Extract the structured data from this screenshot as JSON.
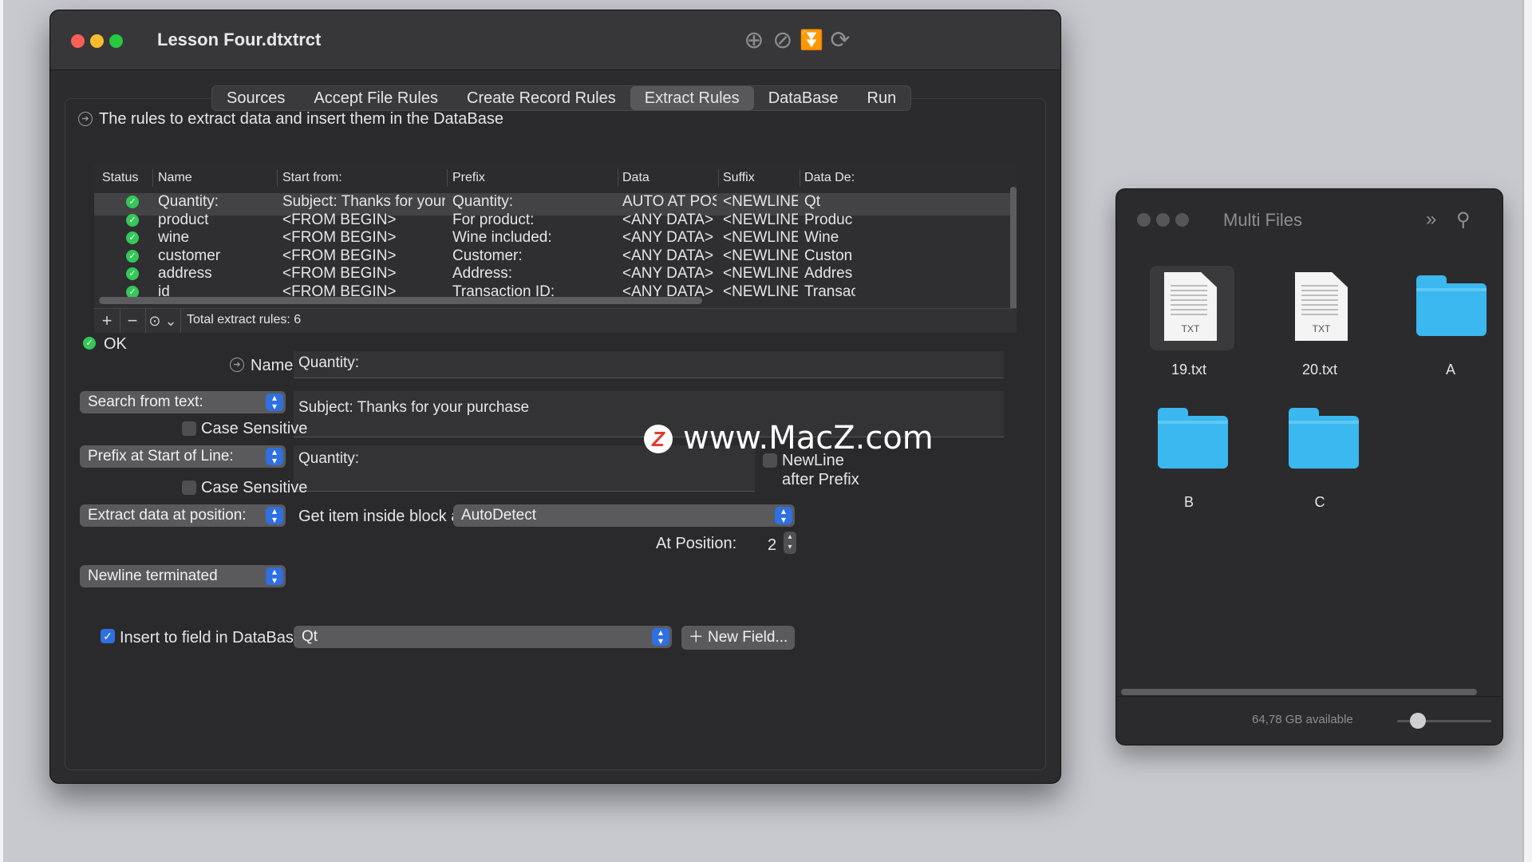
{
  "window": {
    "title": "Lesson Four.dtxtrct",
    "toolbar_icons": [
      "add-circle-icon",
      "block-icon",
      "funnel-icon",
      "refresh-icon"
    ]
  },
  "tabs": [
    "Sources",
    "Accept File Rules",
    "Create Record Rules",
    "Extract Rules",
    "DataBase",
    "Run"
  ],
  "active_tab": "Extract Rules",
  "description": "The rules to extract data and insert them in the DataBase",
  "table": {
    "headers": [
      "Status",
      "Name",
      "Start from:",
      "Prefix",
      "Data",
      "Suffix",
      "Data De:"
    ],
    "rows": [
      {
        "name": "Quantity:",
        "start": "Subject: Thanks for your p...",
        "prefix": "Quantity:",
        "data": "AUTO AT POS...",
        "suffix": "<NEWLINE>",
        "dest": "Qt"
      },
      {
        "name": "product",
        "start": "<FROM BEGIN>",
        "prefix": "For product:",
        "data": "<ANY DATA>",
        "suffix": "<NEWLINE>",
        "dest": "Produc"
      },
      {
        "name": "wine",
        "start": "<FROM BEGIN>",
        "prefix": "Wine included:",
        "data": "<ANY DATA>",
        "suffix": "<NEWLINE>",
        "dest": "Wine"
      },
      {
        "name": "customer",
        "start": "<FROM BEGIN>",
        "prefix": "Customer:",
        "data": "<ANY DATA>",
        "suffix": "<NEWLINE>",
        "dest": "Custon"
      },
      {
        "name": "address",
        "start": "<FROM BEGIN>",
        "prefix": "Address:",
        "data": "<ANY DATA>",
        "suffix": "<NEWLINE>",
        "dest": "Addres"
      },
      {
        "name": "id",
        "start": "<FROM BEGIN>",
        "prefix": "Transaction ID:",
        "data": "<ANY DATA>",
        "suffix": "<NEWLINE>",
        "dest": "Transac"
      }
    ],
    "total_label": "Total extract rules: 6"
  },
  "status": "OK",
  "form": {
    "name_label": "Name:",
    "name_value": "Quantity:",
    "search_popup": "Search from text:",
    "search_value": "Subject: Thanks for your purchase",
    "case_sensitive": "Case Sensitive",
    "prefix_popup": "Prefix at Start of Line:",
    "prefix_value": "Quantity:",
    "newline_after_prefix_1": "NewLine",
    "newline_after_prefix_2": "after Prefix",
    "extract_popup": "Extract data at position:",
    "get_item_label": "Get item inside block as:",
    "get_item_value": "AutoDetect",
    "at_position_label": "At Position:",
    "at_position_value": "2",
    "terminator_popup": "Newline terminated",
    "insert_label": "Insert to field in DataBase:",
    "insert_field_value": "Qt",
    "new_field_button": "New Field..."
  },
  "watermark": "www.MacZ.com",
  "finder": {
    "title": "Multi Files",
    "items": [
      {
        "name": "19.txt",
        "kind": "txt",
        "badge": "TXT"
      },
      {
        "name": "20.txt",
        "kind": "txt",
        "badge": "TXT"
      },
      {
        "name": "A",
        "kind": "folder"
      },
      {
        "name": "B",
        "kind": "folder"
      },
      {
        "name": "C",
        "kind": "folder"
      }
    ],
    "status": "64,78 GB available"
  },
  "colors": {
    "close": "#ff5f57",
    "minimize": "#febc2e",
    "zoom": "#28c840",
    "accent": "#2f6fe0",
    "ok_green": "#34c759",
    "folder": "#3ab8ef"
  }
}
